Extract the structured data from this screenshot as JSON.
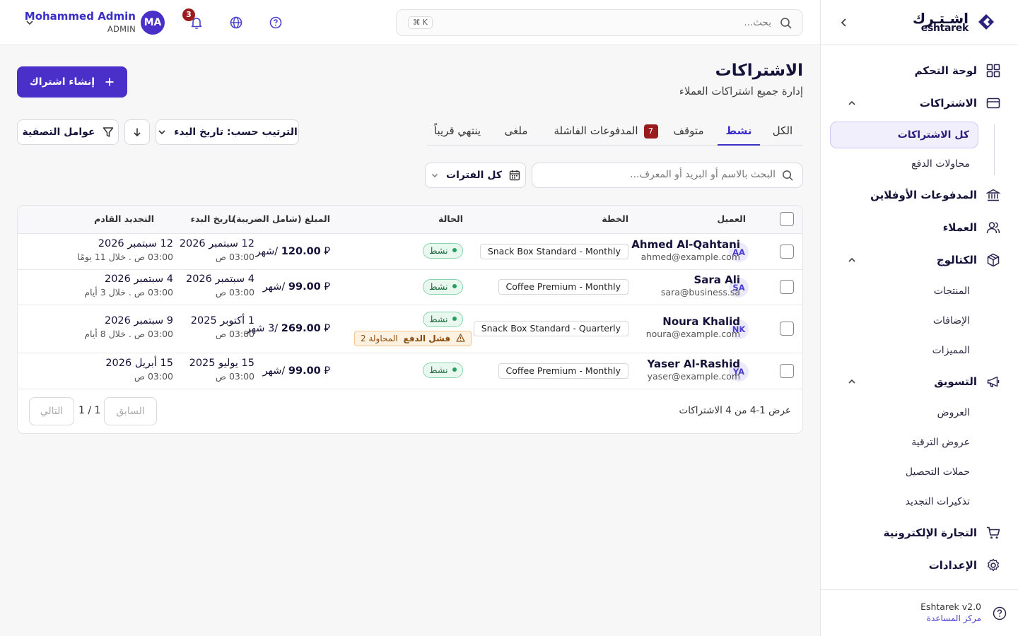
{
  "brand": {
    "name_ar": "اشـتـرك",
    "name_en": "eshtarek"
  },
  "sidebar": {
    "items": [
      {
        "label": "لوحة التحكم",
        "icon": "dashboard-icon"
      },
      {
        "label": "الاشتراكات",
        "icon": "card-icon"
      },
      {
        "label": "المدفوعات الأوفلاين",
        "icon": "bank-icon"
      },
      {
        "label": "العملاء",
        "icon": "users-icon"
      },
      {
        "label": "الكتالوج",
        "icon": "box-icon"
      },
      {
        "label": "التسويق",
        "icon": "megaphone-icon"
      },
      {
        "label": "التجارة الإلكترونية",
        "icon": "cart-icon"
      },
      {
        "label": "الإعدادات",
        "icon": "gear-icon"
      }
    ],
    "subscriptions_sub": [
      "كل الاشتراكات",
      "محاولات الدفع"
    ],
    "catalog_sub": [
      "المنتجات",
      "الإضافات",
      "المميزات"
    ],
    "marketing_sub": [
      "العروض",
      "عروض الترقية",
      "حملات التحصيل",
      "تذكيرات التجديد"
    ],
    "version": "Eshtarek v2.0",
    "help_center": "مركز المساعدة"
  },
  "header": {
    "search_placeholder": "بحث...",
    "shortcut": "⌘ K",
    "notifications_count": "3",
    "user_initials": "MA",
    "user_name": "Mohammed Admin",
    "user_role": "ADMIN"
  },
  "main": {
    "title": "الاشتراكات",
    "subtitle": "إدارة جميع اشتراكات العملاء",
    "create_label": "إنشاء اشتراك",
    "tabs": [
      {
        "label": "الكل"
      },
      {
        "label": "نشط"
      },
      {
        "label": "متوقف"
      },
      {
        "label": "المدفوعات الفاشلة",
        "badge": "7"
      },
      {
        "label": "ملغى"
      },
      {
        "label": "ينتهي قريباً"
      }
    ],
    "sort_label": "الترتيب حسب: تاريخ البدء",
    "filters_label": "عوامل التصفية",
    "search_placeholder": "البحث بالاسم أو البريد أو المعرف...",
    "period_label": "كل الفترات"
  },
  "table": {
    "columns": [
      "العميل",
      "الخطة",
      "الحالة",
      "المبلغ (شامل الضريبة)",
      "تاريخ البدء",
      "التجديد القادم"
    ],
    "rows": [
      {
        "initials": "AA",
        "name": "Ahmed Al-Qahtani",
        "email": "ahmed@example.com",
        "plan": "Snack Box Standard - Monthly",
        "status": "نشط",
        "amount_value": "120.00",
        "currency": "⃁",
        "period": "/شهر",
        "start_date": "12 سبتمبر 2026",
        "start_time": "03:00 ص",
        "next_date": "12 سبتمبر 2026",
        "next_note": "03:00 ص . خلال 11 يومًا"
      },
      {
        "initials": "SA",
        "name": "Sara Ali",
        "email": "sara@business.sa",
        "plan": "Coffee Premium - Monthly",
        "status": "نشط",
        "amount_value": "99.00",
        "currency": "⃁",
        "period": "/شهر",
        "start_date": "4 سبتمبر 2026",
        "start_time": "03:00 ص",
        "next_date": "4 سبتمبر 2026",
        "next_note": "03:00 ص . خلال 3 أيام"
      },
      {
        "initials": "NK",
        "name": "Noura Khalid",
        "email": "noura@example.com",
        "plan": "Snack Box Standard - Quarterly",
        "status": "نشط",
        "fail_label": "فشل الدفع",
        "fail_attempt": "المحاولة 2",
        "amount_value": "269.00",
        "currency": "⃁",
        "period": "/3 شهر",
        "start_date": "1 أكتوبر 2025",
        "start_time": "03:00 ص",
        "next_date": "9 سبتمبر 2026",
        "next_note": "03:00 ص . خلال 8 أيام"
      },
      {
        "initials": "YA",
        "name": "Yaser Al-Rashid",
        "email": "yaser@example.com",
        "plan": "Coffee Premium - Monthly",
        "status": "نشط",
        "amount_value": "99.00",
        "currency": "⃁",
        "period": "/شهر",
        "start_date": "15 يوليو 2025",
        "start_time": "03:00 ص",
        "next_date": "15 أبريل 2026",
        "next_note": "03:00 ص"
      }
    ],
    "showing": "عرض 1-4 من 4 الاشتراكات",
    "prev_label": "السابق",
    "next_label": "التالي",
    "page_count": "1 / 1"
  },
  "colors": {
    "accent": "#4a2fc9",
    "danger": "#9b1c1c",
    "success": "#22a060"
  }
}
